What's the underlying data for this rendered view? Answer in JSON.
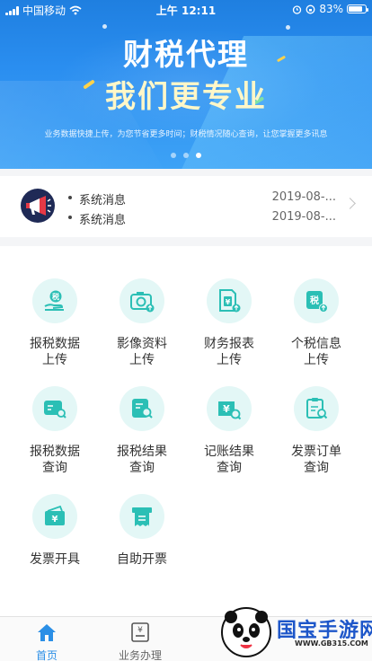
{
  "status_bar": {
    "carrier": "中国移动",
    "time": "上午 12:11",
    "battery": "83%",
    "battery_level": 0.83
  },
  "banner": {
    "title_line1": "财税代理",
    "title_line2": "我们更专业",
    "subtitle": "业务数据快捷上传，为您节省更多时间；财税情况随心查询，让您掌握更多讯息",
    "page_count": 3,
    "active_page": 3
  },
  "notices": {
    "items": [
      {
        "text": "系统消息",
        "date": "2019-08-..."
      },
      {
        "text": "系统消息",
        "date": "2019-08-..."
      }
    ]
  },
  "services": {
    "items": [
      {
        "line1": "报税数据",
        "line2": "上传",
        "icon": "tax-upload-icon"
      },
      {
        "line1": "影像资料",
        "line2": "上传",
        "icon": "camera-upload-icon"
      },
      {
        "line1": "财务报表",
        "line2": "上传",
        "icon": "report-upload-icon"
      },
      {
        "line1": "个税信息",
        "line2": "上传",
        "icon": "personal-tax-upload-icon"
      },
      {
        "line1": "报税数据",
        "line2": "查询",
        "icon": "tax-data-query-icon"
      },
      {
        "line1": "报税结果",
        "line2": "查询",
        "icon": "tax-result-query-icon"
      },
      {
        "line1": "记账结果",
        "line2": "查询",
        "icon": "bookkeeping-query-icon"
      },
      {
        "line1": "发票订单",
        "line2": "查询",
        "icon": "invoice-order-query-icon"
      },
      {
        "line1": "发票开具",
        "line2": "",
        "icon": "invoice-issue-icon"
      },
      {
        "line1": "自助开票",
        "line2": "",
        "icon": "self-invoice-icon"
      }
    ]
  },
  "tabbar": {
    "items": [
      {
        "label": "首页",
        "icon": "home-icon",
        "active": true
      },
      {
        "label": "业务办理",
        "icon": "business-icon",
        "active": false
      }
    ],
    "active_color": "#2b8fe6",
    "inactive_color": "#666666"
  },
  "watermark": {
    "text": "国宝手游网",
    "url": "WWW.GB315.COM"
  },
  "colors": {
    "accent": "#2b8fe6",
    "icon_teal": "#2bbfb5",
    "icon_bg": "#e3f7f6",
    "banner_title2": "#fff7c8"
  }
}
